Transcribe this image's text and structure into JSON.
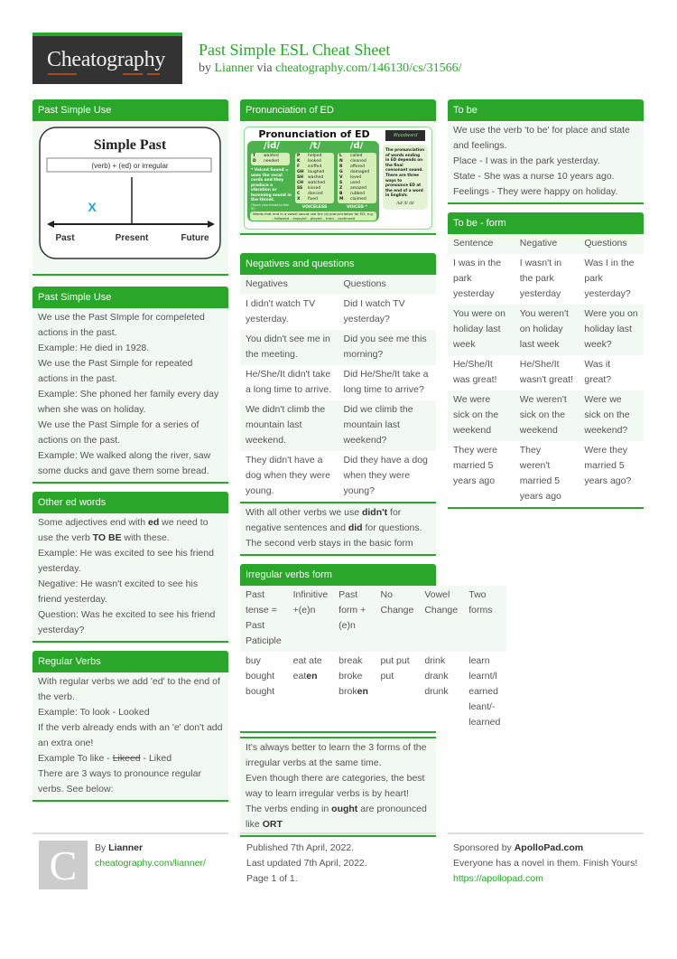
{
  "header": {
    "logo": "Cheatography",
    "title": "Past Simple ESL Cheat Sheet",
    "by": "by",
    "author": "Lianner",
    "via": "via",
    "url": "cheatography.com/146130/cs/31566/"
  },
  "col1": {
    "diagram_section": {
      "title": "Past Simple Use",
      "diagram": {
        "heading": "Simple Past",
        "formula": "(verb) + (ed)  or  irregular",
        "marker": "X",
        "labels": [
          "Past",
          "Present",
          "Future"
        ]
      }
    },
    "use_section": {
      "title": "Past Simple Use",
      "lines": [
        "We use the Past SImple for compeleted actions in the past.",
        "Example: He died in 1928.",
        "We use the Past Simple for repeated actions in the past.",
        "Example: She phoned her family every day when she was on holiday.",
        "We use the Past Simple for a series of actions on the past.",
        "Example: We walked along the river, saw some ducks and gave them some bread."
      ]
    },
    "other_ed": {
      "title": "Other ed words",
      "l1a": "Some adjectives end with ",
      "l1b": "ed",
      "l1c": " we need to use the verb ",
      "l1d": "TO BE",
      "l1e": " with these.",
      "l2": "Example: He was excited to see his friend yesterday.",
      "l3": "Negative: He wasn't excited to see his friend yesterday.",
      "l4": "Question: Was he excited to see his friend yesterday?"
    },
    "regular": {
      "title": "Regular Verbs",
      "l1": "With regular verbs we add 'ed' to the end of the verb.",
      "l2": "Example: To look - Looked",
      "l3": "If the verb already ends with an 'e' don't add an extra one!",
      "l4a": "Example To like - ",
      "l4b": "Likeed",
      "l4c": " - Liked",
      "l5": "There are 3 ways to pronounce regular verbs. See below:"
    }
  },
  "col2": {
    "pron": {
      "title": "Pronunciation of ED",
      "image_title": "Pronunciation of ED",
      "groups": [
        {
          "label": "/id/",
          "rows": [
            [
              "T",
              "wanted"
            ],
            [
              "D",
              "needed"
            ]
          ]
        },
        {
          "label": "/t/",
          "rows": [
            [
              "P",
              "helped"
            ],
            [
              "K",
              "looked"
            ],
            [
              "F",
              "sniffed"
            ],
            [
              "GH",
              "laughed"
            ],
            [
              "SH",
              "washed"
            ],
            [
              "CH",
              "watched"
            ],
            [
              "SS",
              "kissed"
            ],
            [
              "C",
              "danced"
            ],
            [
              "X",
              "fixed"
            ]
          ],
          "footer": "VOICELESS"
        },
        {
          "label": "/d/",
          "rows": [
            [
              "L",
              "called"
            ],
            [
              "N",
              "cleaned"
            ],
            [
              "R",
              "offered"
            ],
            [
              "G",
              "damaged"
            ],
            [
              "V",
              "loved"
            ],
            [
              "S",
              "used"
            ],
            [
              "Z",
              "amazed"
            ],
            [
              "B",
              "rubbed"
            ],
            [
              "M",
              "claimed"
            ]
          ],
          "footer": "VOICED *"
        }
      ],
      "voiced_note": "* Voiced Sound = uses the vocal cords and they produce a vibration or humming sound in the throat.",
      "touch_note": "(Touch your throat to feel it!)",
      "side_note": "The pronunciation of words ending in ED depends on the final consonant sound. There are three ways to pronounce ED at the end of a word in English:",
      "side_ipa": "/id/  /t/  /d/",
      "bottom_note": "Words that end in a vowel sound use the /d/ pronunciation for ED: e.g. – followed – enjoyed – played – tried – continued",
      "badge": "Woodward"
    },
    "negq": {
      "title": "Negatives and questions",
      "headers": [
        "Negatives",
        "Questions"
      ],
      "rows": [
        [
          "I didn't watch TV yesterday.",
          "Did I watch TV yesterday?"
        ],
        [
          "You didn't see me in the meeting.",
          "Did you see me this morning?"
        ],
        [
          "He/She/It didn't take a long time to arrive.",
          "Did He/She/It take a long time to arrive?"
        ],
        [
          "We didn't climb the mountain last weekend.",
          "Did we climb the mountain last weekend?"
        ],
        [
          "They didn't have a dog when they were young.",
          "Did they have a dog when they were young?"
        ]
      ],
      "n1": "With all other verbs we use ",
      "n2": "didn't",
      "n3": " for negative sentences and ",
      "n4": "did",
      "n5": " for questions.",
      "n6": "The second verb stays in the basic form"
    },
    "irregular": {
      "title": "Irregular verbs form",
      "headers": [
        "Past tense = Past Paticiple",
        "Infinitive +(e)n",
        "Past form + (e)n",
        "No Change",
        "Vowel Change",
        "Two forms"
      ],
      "c1": "buy bought bought",
      "c2a": "eat ate eat",
      "c2b": "en",
      "c3a": "break broke brok",
      "c3b": "en",
      "c4": "put put put",
      "c5": "drink drank drunk",
      "c6": "learn learnt/l earned leant/- learned",
      "t1": "It's always better to learn the 3 forms of the irregular verbs at the same time.",
      "t2": "Even though there are categories, the best way to learn irregular verbs is by heart!",
      "t3a": "The verbs ending in ",
      "t3b": "ought",
      "t3c": " are pronounced like ",
      "t3d": "ORT"
    }
  },
  "col3": {
    "tobe": {
      "title": "To be",
      "lines": [
        "We use the verb 'to be' for place and state and feelings.",
        "Place - I was in the park yesterday.",
        "State - She was a nurse 10 years ago.",
        "Feelings - They were happy on holiday."
      ]
    },
    "tobeform": {
      "title": "To be - form",
      "headers": [
        "Sentence",
        "Negative",
        "Questions"
      ],
      "rows": [
        [
          "I was in the park yesterday",
          "I wasn't in the park yesterday",
          "Was I in the park yesterday?"
        ],
        [
          "You were on holiday last week",
          "You weren't on holiday last week",
          "Were you on holiday last week?"
        ],
        [
          "He/She/It was great!",
          "He/She/It wasn't great!",
          "Was it great?"
        ],
        [
          "We were sick on the weekend",
          "We weren't sick on the weekend",
          "Were we sick on the weekend?"
        ],
        [
          "They were married 5 years ago",
          "They weren't married 5 years ago",
          "Were they married 5 years ago?"
        ]
      ]
    }
  },
  "footer": {
    "avatar_letter": "C",
    "by": "By ",
    "author": "Lianner",
    "author_url": "cheatography.com/lianner/",
    "published": "Published 7th April, 2022.",
    "updated": "Last updated 7th April, 2022.",
    "page": "Page 1 of 1.",
    "sponsored": "Sponsored by ",
    "sponsor": "ApolloPad.com",
    "sponsor_text": "Everyone has a novel in them. Finish Yours!",
    "sponsor_url": "https://apollopad.com"
  }
}
